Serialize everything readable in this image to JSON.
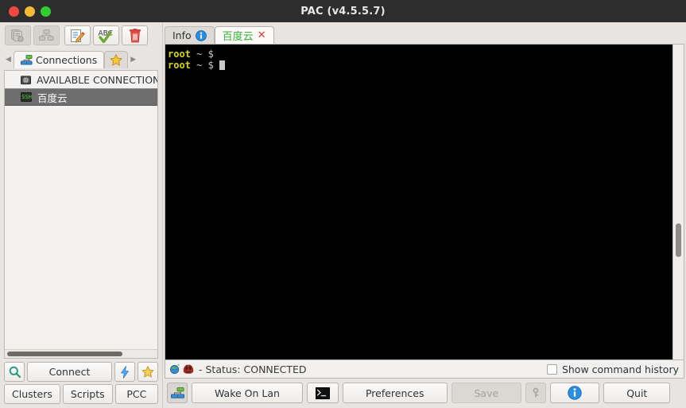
{
  "window": {
    "title": "PAC (v4.5.5.7)",
    "controls": [
      {
        "name": "close",
        "color": "#ef4a42"
      },
      {
        "name": "minimize",
        "color": "#f5bb34"
      },
      {
        "name": "maximize",
        "color": "#32cd32"
      }
    ]
  },
  "toolbar": {
    "buttons": [
      {
        "name": "clone-connection",
        "icon": "copy-icon",
        "enabled": false
      },
      {
        "name": "group-connection",
        "icon": "cluster-icon",
        "enabled": false
      },
      {
        "name": "edit-connection",
        "icon": "edit-pencil-icon",
        "enabled": true
      },
      {
        "name": "check-spelling",
        "icon": "abc-check-icon",
        "enabled": true
      },
      {
        "name": "delete-connection",
        "icon": "trash-icon",
        "enabled": true
      }
    ]
  },
  "sidebar": {
    "tabs": [
      {
        "label": "Connections",
        "icon": "network-tree-icon",
        "active": true
      },
      {
        "label": "",
        "icon": "star-icon",
        "active": false
      }
    ],
    "nav_prev": "◀",
    "nav_next": "▶",
    "tree": [
      {
        "label": "AVAILABLE CONNECTIONS",
        "icon": "folder-globe-icon",
        "selected": false
      },
      {
        "label": "百度云",
        "icon": "ssh-terminal-icon",
        "selected": true
      }
    ],
    "buttons_row1": [
      {
        "label": "",
        "name": "search-button",
        "icon": "search-icon"
      },
      {
        "label": "Connect",
        "name": "connect-button",
        "icon": ""
      },
      {
        "label": "",
        "name": "quick-connect-button",
        "icon": "lightning-icon"
      },
      {
        "label": "",
        "name": "favourites-button",
        "icon": "star-icon"
      }
    ],
    "buttons_row2": [
      {
        "label": "Clusters",
        "name": "clusters-button"
      },
      {
        "label": "Scripts",
        "name": "scripts-button"
      },
      {
        "label": "PCC",
        "name": "pcc-button"
      }
    ]
  },
  "terminal_tabs": [
    {
      "label": "Info",
      "icon": "info-icon",
      "active": false,
      "closable": false
    },
    {
      "label": "百度云",
      "icon": "",
      "active": true,
      "closable": true,
      "close_glyph": "✕"
    }
  ],
  "terminal": {
    "lines": [
      {
        "user": "root",
        "path": "~",
        "prompt": "$",
        "command": ""
      },
      {
        "user": "root",
        "path": "~",
        "prompt": "$",
        "command": ""
      }
    ],
    "colors": {
      "background": "#000000",
      "user": "#d8d800",
      "text": "#c8c8c8",
      "cursor": "#c9c9c9"
    }
  },
  "statusbar": {
    "icons": [
      "globe-icon",
      "monster-icon"
    ],
    "text": "- Status: CONNECTED",
    "checkbox": {
      "label": "Show command history",
      "checked": false
    }
  },
  "actionbar": [
    {
      "label": "",
      "name": "connections-toggle-button",
      "icon": "network-tree-icon",
      "enabled": true,
      "pressed": true
    },
    {
      "label": "Wake On Lan",
      "name": "wake-on-lan-button",
      "enabled": true
    },
    {
      "label": "",
      "name": "local-shell-button",
      "icon": "terminal-icon",
      "enabled": true
    },
    {
      "label": "Preferences",
      "name": "preferences-button",
      "enabled": true
    },
    {
      "label": "Save",
      "name": "save-button",
      "enabled": false
    },
    {
      "label": "",
      "name": "lock-button",
      "icon": "key-icon",
      "enabled": false
    },
    {
      "label": "",
      "name": "about-button",
      "icon": "info-icon",
      "enabled": true
    },
    {
      "label": "Quit",
      "name": "quit-button",
      "enabled": true
    }
  ]
}
